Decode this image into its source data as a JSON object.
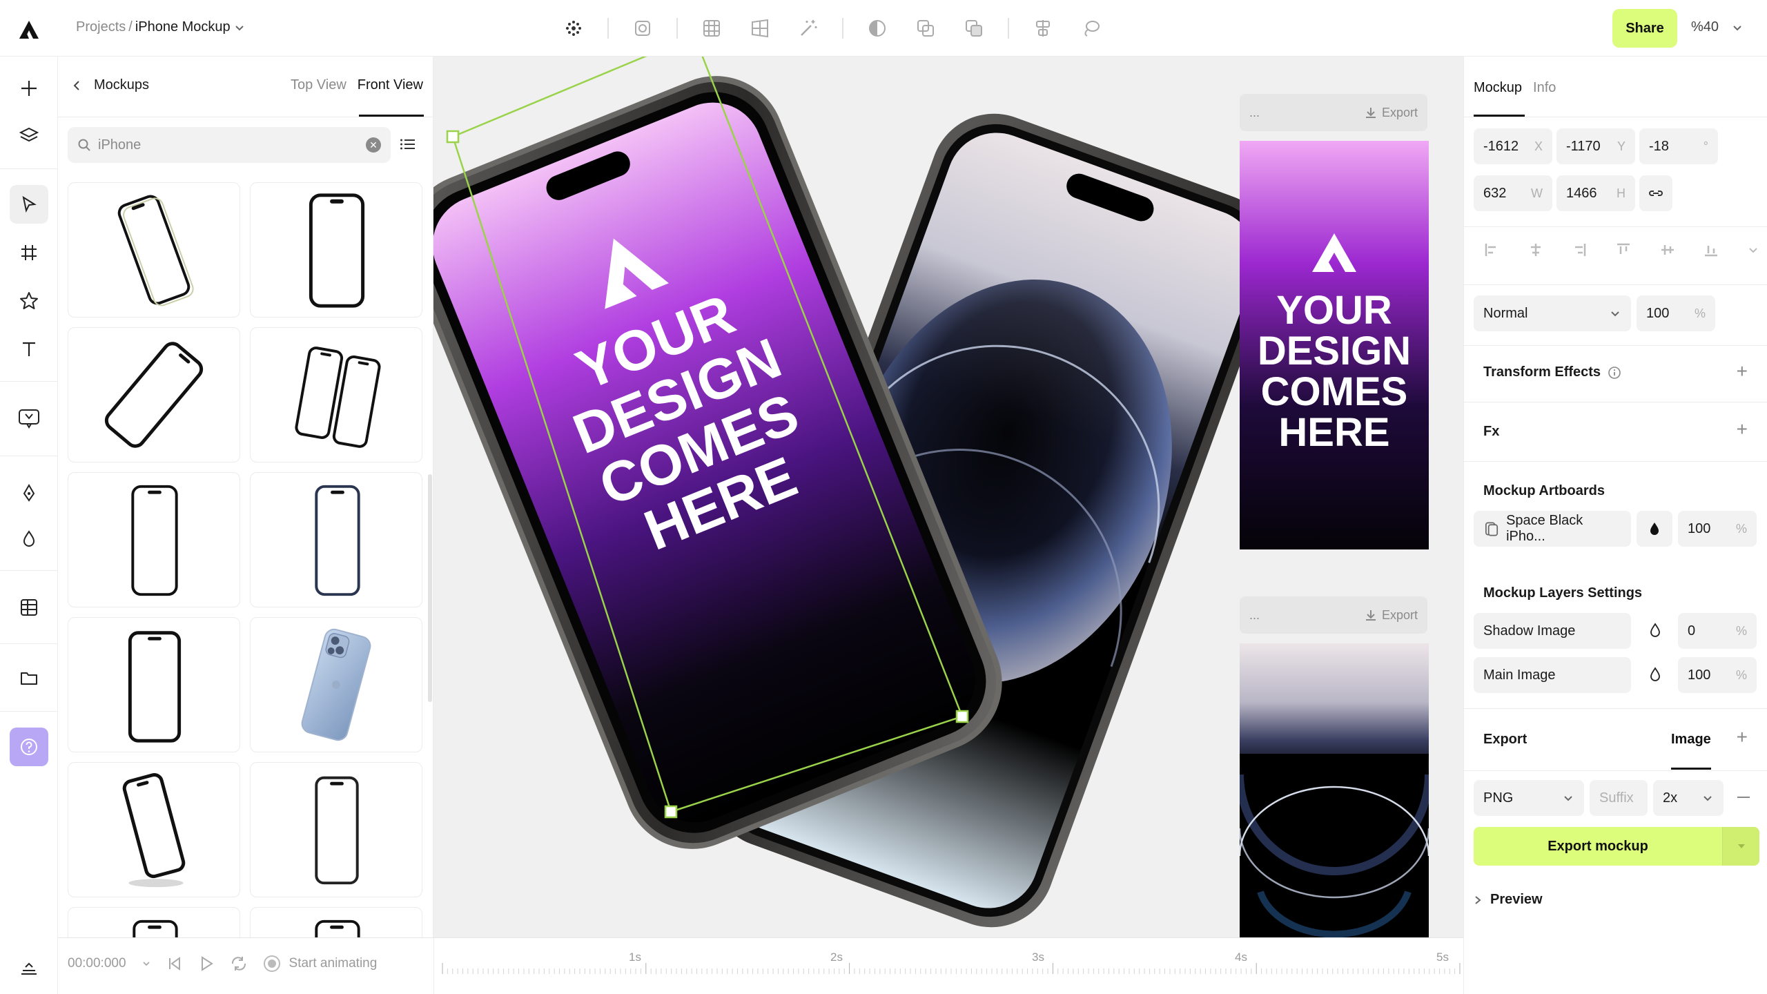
{
  "app": {
    "breadcrumb_root": "Projects",
    "breadcrumb_sep": "/",
    "breadcrumb_current": "iPhone Mockup",
    "share_label": "Share",
    "zoom_label": "%40"
  },
  "toolbar_icons": [
    "shader-icon",
    "mask-icon",
    "grid-icon",
    "perspective-icon",
    "magic-wand-icon",
    "contrast-icon",
    "union-icon",
    "subtract-icon",
    "align-icon",
    "lasso-icon"
  ],
  "left_panel": {
    "back_title": "Mockups",
    "tab_top": "Top View",
    "tab_front": "Front View",
    "search_value": "iPhone"
  },
  "canvas": {
    "screen_text": [
      "YOUR",
      "DESIGN",
      "COMES",
      "HERE"
    ],
    "export_label": "Export",
    "artboard_dots": "..."
  },
  "timeline": {
    "time": "00:00:000",
    "start_label": "Start animating",
    "ticks": [
      "1s",
      "2s",
      "3s",
      "4s",
      "5s"
    ]
  },
  "right_panel": {
    "tab_mockup": "Mockup",
    "tab_info": "Info",
    "x_value": "-1612",
    "x_suffix": "X",
    "y_value": "-1170",
    "y_suffix": "Y",
    "rot_value": "-18",
    "rot_suffix": "°",
    "w_value": "632",
    "w_suffix": "W",
    "h_value": "1466",
    "h_suffix": "H",
    "blend_mode": "Normal",
    "opacity": "100",
    "percent": "%",
    "transform_effects": "Transform Effects",
    "fx": "Fx",
    "mockup_artboards": "Mockup Artboards",
    "artboard_name": "Space Black iPho...",
    "artboard_opacity": "100",
    "layers_settings": "Mockup Layers Settings",
    "shadow_image": "Shadow Image",
    "shadow_value": "0",
    "main_image": "Main Image",
    "main_value": "100",
    "export_title": "Export",
    "export_type": "Image",
    "format": "PNG",
    "suffix_placeholder": "Suffix",
    "scale": "2x",
    "export_mockup": "Export mockup",
    "preview": "Preview"
  },
  "colors": {
    "accent": "#dcfc7c",
    "selection": "#9ad24a",
    "screen_top": "#f0b6f4",
    "screen_mid": "#8a22c8",
    "screen_bottom": "#050308"
  }
}
